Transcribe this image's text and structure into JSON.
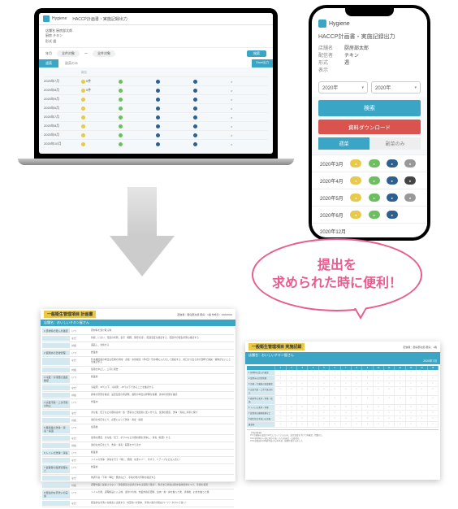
{
  "laptop": {
    "logo_text": "Hygiene",
    "header_title": "HACCP計画書・実施記録出力",
    "meta": {
      "store_lbl": "店舗名",
      "store": "厨房部太郎",
      "tenant_lbl": "厨房",
      "tenant": "チキン",
      "type_lbl": "形式",
      "type": "週"
    },
    "filter": {
      "year": "全件対象",
      "search": "検索"
    },
    "tabs": {
      "t1": "週菜",
      "t2": "副菜のみ",
      "last": "Excel出力"
    },
    "thead": {
      "c1": "",
      "c2": "報告",
      "c3": "",
      "c4": "",
      "c5": "",
      "c6": ""
    },
    "rows": [
      {
        "d": "2020年7月",
        "a": "0件",
        "b": "",
        "c": "",
        "e": ""
      },
      {
        "d": "2020年8月",
        "a": "0件",
        "b": "",
        "c": "",
        "e": ""
      },
      {
        "d": "2020年9月",
        "a": "",
        "b": "",
        "c": "",
        "e": ""
      },
      {
        "d": "2020年6月",
        "a": "",
        "b": "",
        "c": "",
        "e": ""
      },
      {
        "d": "2020年7月",
        "a": "",
        "b": "",
        "c": "",
        "e": ""
      },
      {
        "d": "2020年8月",
        "a": "",
        "b": "",
        "c": "",
        "e": ""
      },
      {
        "d": "2020年9月",
        "a": "",
        "b": "",
        "c": "",
        "e": ""
      },
      {
        "d": "2020年10月",
        "a": "",
        "b": "",
        "c": "",
        "e": ""
      }
    ]
  },
  "phone": {
    "logo_text": "Hygiene",
    "title": "HACCP計画書・実施記録出力",
    "meta": {
      "store_lbl": "店舗名",
      "store": "厨房部太郎",
      "tenant_lbl": "配信者",
      "tenant": "チキン",
      "type_lbl": "形式",
      "type": "週",
      "view_lbl": "表示"
    },
    "sel1": "2020年",
    "sel2": "2020年",
    "search": "検索",
    "download": "資料ダウンロード",
    "tabs": {
      "t1": "週菜",
      "t2": "副菜のみ"
    },
    "rows": [
      {
        "d": "2020年3月"
      },
      {
        "d": "2020年4月"
      },
      {
        "d": "2020年5月"
      },
      {
        "d": "2020年6月"
      },
      {
        "d": "2020年12月"
      }
    ]
  },
  "bubble": "提出を\n求められた時に便利！",
  "doc1": {
    "title": "一般衛生管理項目 計画書",
    "sub": "店舗名：おいしいチキン屋さん",
    "meta": "配信者：厨房部太郎 厨房：1番 作成日：2020/8/26",
    "rows": [
      {
        "n": "1 原材料の受入れ確認",
        "w": "いつ",
        "t": "原材料を受け取る時"
      },
      {
        "n": "",
        "w": "なぜ",
        "t": "外観、におい、包装の状態、表示（期限、保存方法）、配送温度を確認する、配送車の衛生状態も確認する"
      },
      {
        "n": "",
        "w": "対処",
        "t": "返品し、交換する"
      },
      {
        "n": "2 使用水の日常管理",
        "w": "いつ",
        "t": "始業前"
      },
      {
        "n": "",
        "w": "なぜ",
        "t": "貯水槽使用の場合は定期の清掃・点検・水質検査（年2回）貯水槽にふたをして施錠する、蛇口から出る水が透明で異臭・異物がないことを確認する"
      },
      {
        "n": "",
        "w": "対処",
        "t": "使用を中止し、上司に報告"
      },
      {
        "n": "3 冷蔵・冷凍庫の温度確認",
        "w": "いつ",
        "t": "始業前"
      },
      {
        "n": "",
        "w": "なぜ",
        "t": "冷蔵庫：10℃以下、冷凍庫：-15℃以下であることを確認する"
      },
      {
        "n": "",
        "w": "対処",
        "t": "異常の原因を確認、設定温度の再調整、故障の場合は修理を依頼、食材の状態を確認"
      },
      {
        "n": "4 交差汚染・二次汚染の防止",
        "w": "いつ",
        "t": "作業中"
      },
      {
        "n": "",
        "w": "なぜ",
        "t": "まな板、包丁などの器具は肉・魚・野菜など用途別に使い分ける、使用の都度、洗浄・消毒し清潔に保つ"
      },
      {
        "n": "",
        "w": "対処",
        "t": "適切な対応をとり、必要によって洗浄・消毒・廃棄"
      },
      {
        "n": "5 器具等の洗浄・消毒・殺菌",
        "w": "いつ",
        "t": "使用後"
      },
      {
        "n": "",
        "w": "なぜ",
        "t": "使用の都度、まな板、包丁、ボウルなどの器具類を洗浄し、消毒（殺菌）する"
      },
      {
        "n": "",
        "w": "対処",
        "t": "適切な対応をとり、洗浄・消毒・殺菌をやり直す"
      },
      {
        "n": "6 トイレの洗浄・消毒",
        "w": "いつ",
        "t": "終業後"
      },
      {
        "n": "",
        "w": "なぜ",
        "t": "トイレの洗浄・消毒を行う（特に、便座、水洗レバー、手すり、ドアノブなどは入念に）"
      },
      {
        "n": "7 従事者の健康管理など",
        "w": "いつ",
        "t": "始業前"
      },
      {
        "n": "",
        "w": "なぜ",
        "t": "体調不良（下痢・嘔吐・発熱など）、手指の傷の有無を確認する"
      },
      {
        "n": "",
        "w": "対処",
        "t": "調理作業に従事させない（消化器系の症状があれば病院で受診）、傷がある場合は耐水性絆創膏をつけ、手袋を着用"
      },
      {
        "n": "8 衛生的な手洗いの実施",
        "w": "いつ",
        "t": "トイレの後、調理施設に入る前、盛付けの前、作業内容変更時、生肉・魚・卵を触った後、清掃後、お金を触った後"
      },
      {
        "n": "",
        "w": "なぜ",
        "t": "衛生的な手洗いを確実に実施する（2回洗いが基本、手洗い後の手指はペーパータオルで拭く）"
      }
    ]
  },
  "doc2": {
    "title": "一般衛生管理項目 実施記録",
    "sub": "店舗名：おいしいチキン屋さん",
    "meta": "配信者：厨房部太郎 厨房：1番",
    "month": "2020年7月",
    "days": [
      "1",
      "2",
      "3",
      "4",
      "5",
      "6",
      "7",
      "8",
      "9",
      "10",
      "11",
      "12",
      "13",
      "14",
      "15"
    ],
    "rows": [
      "1 原材料の受入れ確認",
      "2 使用水の日常管理",
      "3 冷蔵・冷凍庫の温度確認",
      "4 交差汚染・二次汚染の防止",
      "5 器具等の洗浄・消毒・殺菌",
      "6 トイレの洗浄・消毒",
      "7 従事者の健康管理など",
      "8 衛生的な手洗いの実施",
      "確認者"
    ],
    "val": "○",
    "notes": "【特記事項】\n7/3 冷蔵庫の温度が12℃になっていたため、設定温度を下げて再確認、問題なし\n7/10 原材料の一部に傷みがあったため返品・交換対応\n7/15 従業員Aが体調不良のため早退、調理作業から外した"
  }
}
